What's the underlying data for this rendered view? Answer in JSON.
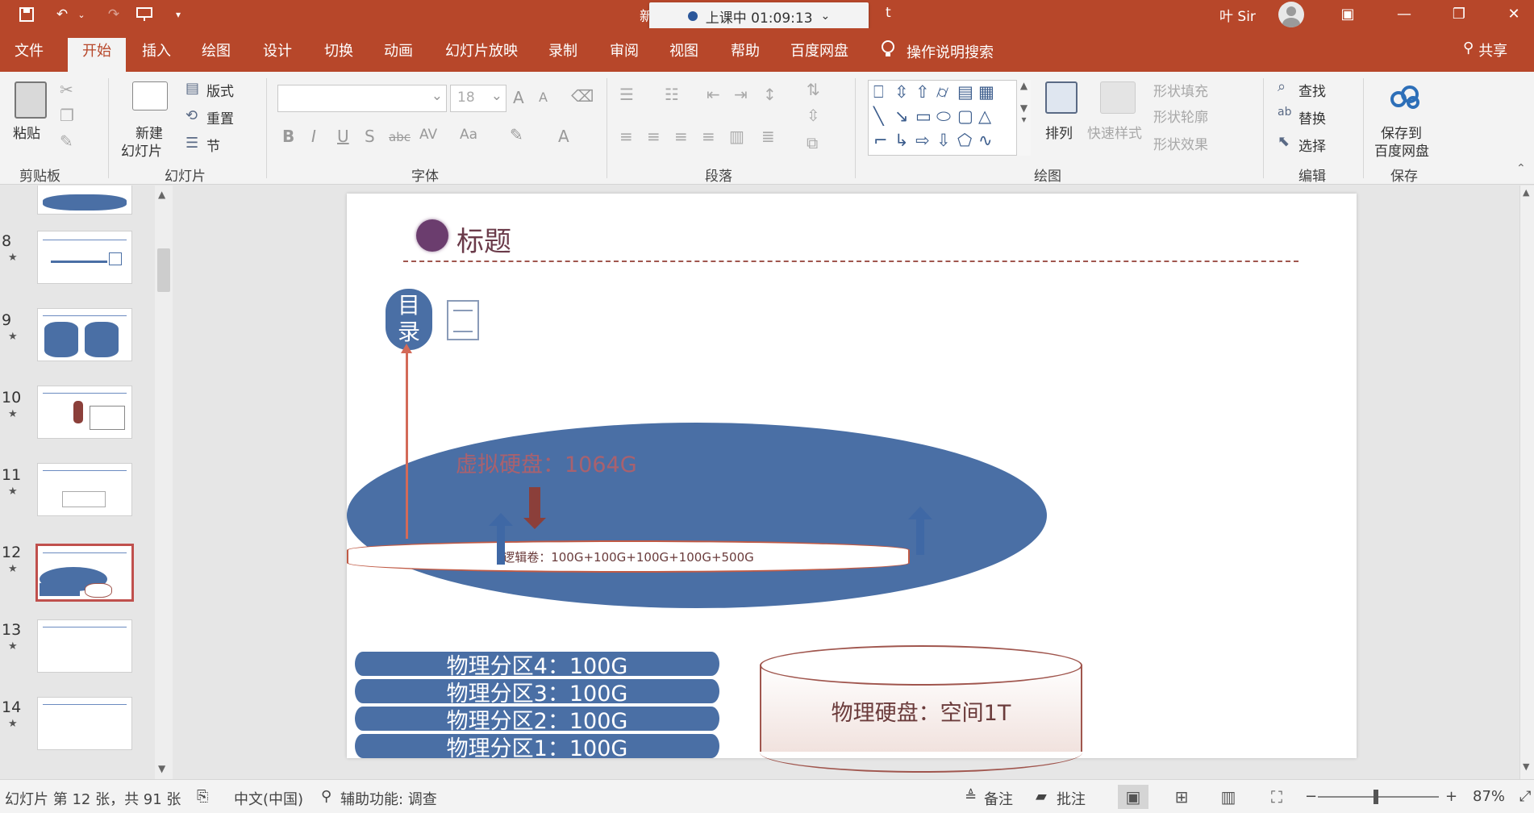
{
  "titlebar": {
    "doc_title_left": "新",
    "doc_title_right": "t",
    "recording_status": "上课中 01:09:13",
    "user_name": "叶 Sir",
    "qat": {
      "save_icon": "save-icon",
      "undo_icon": "undo-icon",
      "redo_icon": "redo-icon",
      "present_icon": "present-icon"
    },
    "window": {
      "restore_ribbon": "▣",
      "minimize": "—",
      "maximize": "❐",
      "close": "✕"
    }
  },
  "tabs": [
    "文件",
    "开始",
    "插入",
    "绘图",
    "设计",
    "切换",
    "动画",
    "幻灯片放映",
    "录制",
    "审阅",
    "视图",
    "帮助",
    "百度网盘"
  ],
  "active_tab": "开始",
  "help_search": "操作说明搜索",
  "share": "共享",
  "ribbon": {
    "clipboard": {
      "label": "剪贴板",
      "paste": "粘贴"
    },
    "slides": {
      "label": "幻灯片",
      "new_slide_1": "新建",
      "new_slide_2": "幻灯片",
      "layout": "版式",
      "reset": "重置",
      "section": "节"
    },
    "font": {
      "label": "字体",
      "font_size": "18",
      "bold": "B",
      "italic": "I",
      "underline": "U",
      "strike": "S",
      "grow": "A",
      "shrink": "A",
      "font_color": "A",
      "abc": "abc",
      "spacing": "AV",
      "case": "Aa"
    },
    "paragraph": {
      "label": "段落"
    },
    "drawing": {
      "label": "绘图",
      "arrange": "排列",
      "quick_styles": "快速样式",
      "shape_fill": "形状填充",
      "shape_outline": "形状轮廓",
      "shape_effect": "形状效果"
    },
    "editing": {
      "label": "编辑",
      "find": "查找",
      "replace": "替换",
      "select": "选择"
    },
    "save": {
      "label": "保存",
      "save_to_1": "保存到",
      "save_to_2": "百度网盘"
    }
  },
  "thumbnails": [
    {
      "num": "8"
    },
    {
      "num": "9"
    },
    {
      "num": "10"
    },
    {
      "num": "11"
    },
    {
      "num": "12",
      "selected": true
    },
    {
      "num": "13"
    },
    {
      "num": "14"
    }
  ],
  "slide": {
    "title": "标题",
    "directory_1": "目",
    "directory_2": "录",
    "virtual_disk": "虚拟硬盘：1064G",
    "logical_volume": "逻辑卷：100G+100G+100G+100G+500G",
    "partitions": [
      "物理分区4：100G",
      "物理分区3：100G",
      "物理分区2：100G",
      "物理分区1：100G"
    ],
    "physical_disk": "物理硬盘：空间1T"
  },
  "statusbar": {
    "slide_info": "幻灯片 第 12 张，共 91 张",
    "language": "中文(中国)",
    "accessibility": "辅助功能: 调查",
    "notes": "备注",
    "comments": "批注",
    "zoom": "87%",
    "zoom_minus": "−",
    "zoom_plus": "+"
  },
  "colors": {
    "accent": "#b7472a",
    "slide_blue": "#4a6fa5",
    "selection": "#c0504d"
  }
}
